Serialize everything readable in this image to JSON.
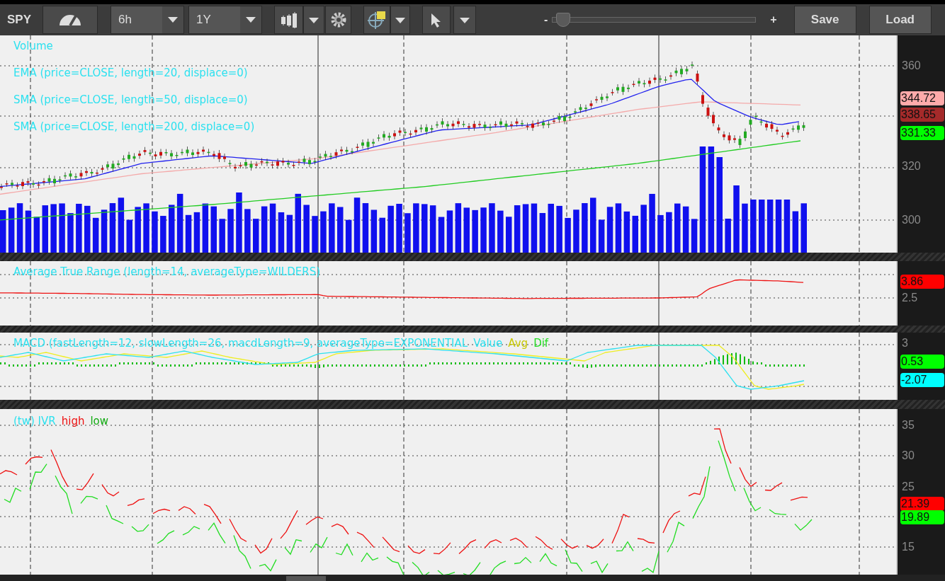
{
  "toolbar": {
    "symbol": "SPY",
    "timeframe": "6h",
    "range": "1Y",
    "zoom": {
      "minus": "-",
      "plus": "+",
      "level": 0.02
    },
    "buttons": [
      "Save",
      "Load"
    ]
  },
  "panes": [
    {
      "kind": "price",
      "legend": [
        {
          "text": "Volume",
          "color": "#2de1ef"
        },
        {
          "text": "EMA (price=CLOSE, length=20, displace=0)",
          "color": "#2de1ef"
        },
        {
          "text": "SMA (price=CLOSE, length=50, displace=0)",
          "color": "#2de1ef"
        },
        {
          "text": "SMA (price=CLOSE, length=200, displace=0)",
          "color": "#2de1ef"
        }
      ],
      "axis_labels": [
        "360",
        "320",
        "300"
      ],
      "badges": [
        {
          "text": "344.72",
          "color": "#ffaaaa"
        },
        {
          "text": "338.65",
          "color": "#a52a2a"
        },
        {
          "text": "331.33",
          "color": "#00ff00"
        }
      ]
    },
    {
      "kind": "atr",
      "legend": [
        {
          "text": "Average True Range (length=14, averageType=WILDERS)",
          "color": "#2de1ef"
        }
      ],
      "axis_labels": [
        "2.5"
      ],
      "badges": [
        {
          "text": "3.86",
          "color": "#ff0000"
        }
      ]
    },
    {
      "kind": "macd",
      "legend": [
        {
          "text": "MACD (fastLength=12, slowLength=26, macdLength=9, averageType=EXPONENTIAL",
          "color": "#2de1ef"
        },
        {
          "text": "Value",
          "color": "#2de1ef"
        },
        {
          "text": "Avg",
          "color": "#c8c800"
        },
        {
          "text": "Dif",
          "color": "#22dd22"
        }
      ],
      "axis_labels": [
        "3"
      ],
      "badges": [
        {
          "text": "0.53",
          "color": "#00ff00"
        },
        {
          "text": "-2.07",
          "color": "#00ffff"
        }
      ]
    },
    {
      "kind": "ivr",
      "legend": [
        {
          "text": "(tw) IVR",
          "color": "#2de1ef"
        },
        {
          "text": "high",
          "color": "#ee1111"
        },
        {
          "text": "low",
          "color": "#11aa11"
        }
      ],
      "axis_labels": [
        "35",
        "30",
        "25",
        "15"
      ],
      "badges": [
        {
          "text": "21.39",
          "color": "#ff0000"
        },
        {
          "text": "19.89",
          "color": "#00ff00"
        }
      ]
    }
  ]
}
